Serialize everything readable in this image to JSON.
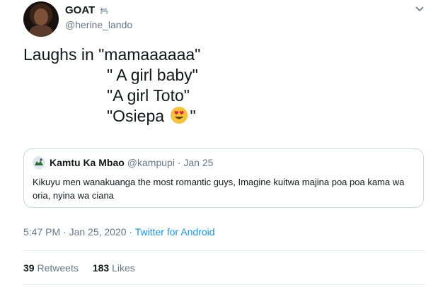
{
  "author": {
    "name": "GOAT",
    "handle": "@herine_lando",
    "badge_icon": "goat-icon"
  },
  "tweet": {
    "lines": [
      "Laughs in \"mamaaaaaa\"",
      "\" A girl baby\"",
      "\"A girl Toto\"",
      "\"Osiepa ",
      "\""
    ],
    "emoji": "heart-eyes-emoji"
  },
  "quoted": {
    "name": "Kamtu Ka Mbao",
    "handle_date": "@kampupi · Jan 25",
    "text": "Kikuyu men wanakuanga the most romantic guys, Imagine kuitwa majina poa poa kama wa oria, nyina wa ciana"
  },
  "meta": {
    "time_date": "5:47 PM · Jan 25, 2020 · ",
    "source": "Twitter for Android"
  },
  "stats": {
    "retweets_count": "39",
    "retweets_label": "Retweets",
    "likes_count": "183",
    "likes_label": "Likes"
  },
  "colors": {
    "link": "#1b95e0",
    "muted": "#657786",
    "border": "#ccd6dd"
  }
}
